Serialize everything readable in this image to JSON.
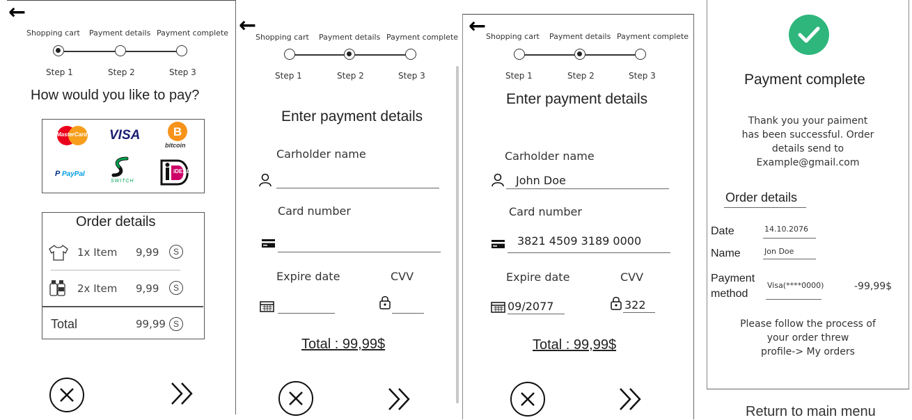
{
  "steps": {
    "names": [
      "Shopping cart",
      "Payment details",
      "Payment complete"
    ],
    "labels": [
      "Step 1",
      "Step 2",
      "Step 3"
    ]
  },
  "screen1": {
    "title": "How would you like to pay?",
    "payment_methods": [
      "MasterCard",
      "VISA",
      "bitcoin",
      "PayPal",
      "SWITCH",
      "iDEAL"
    ],
    "order": {
      "title": "Order details",
      "items": [
        {
          "label": "1x Item",
          "price": "9,99",
          "icon": "shirt-icon"
        },
        {
          "label": "2x Item",
          "price": "9,99",
          "icon": "bottles-icon"
        }
      ],
      "total_label": "Total",
      "total_value": "99,99",
      "currency_symbol": "S"
    }
  },
  "screen2": {
    "title": "Enter payment details",
    "cardholder_label": "Carholder name",
    "card_label": "Card number",
    "expire_label": "Expire date",
    "cvv_label": "CVV",
    "total": "Total : 99,99$"
  },
  "screen3": {
    "title": "Enter payment details",
    "cardholder_label": "Carholder name",
    "cardholder_value": "John Doe",
    "card_label": "Card number",
    "card_value": "3821 4509 3189 0000",
    "expire_label": "Expire date",
    "expire_value": "09/2077",
    "cvv_label": "CVV",
    "cvv_value": "322",
    "total": "Total : 99,99$"
  },
  "screen4": {
    "title": "Payment complete",
    "message": [
      "Thank you your paiment",
      "has been successful. Order",
      "details send to",
      "Example@gmail.com"
    ],
    "order_title": "Order details",
    "date_label": "Date",
    "date_value": "14.10.2076",
    "name_label": "Name",
    "name_value": "Jon Doe",
    "method_label_1": "Payment",
    "method_label_2": "method",
    "method_value": "Visa(****0000)",
    "amount": "-99,99$",
    "follow": [
      "Please follow the process of",
      "your order threw",
      "profile-> My orders"
    ],
    "return_label": "Return to main menu"
  },
  "colors": {
    "success": "#2eb67d",
    "mastercard_red": "#eb001b",
    "mastercard_orange": "#f79e1b",
    "visa_blue": "#1a1f71",
    "bitcoin_orange": "#f7931a",
    "paypal_blue": "#003087",
    "switch_green": "#00a650",
    "ideal_pink": "#cc0066"
  }
}
